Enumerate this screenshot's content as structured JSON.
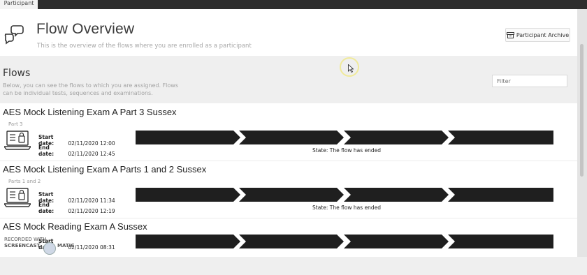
{
  "top_tab": {
    "label": "Participant"
  },
  "header": {
    "title": "Flow Overview",
    "subtitle": "This is the overview of the flows where you are enrolled as a participant",
    "archive_button": "Participant Archive"
  },
  "flows_section": {
    "title": "Flows",
    "description": "Below, you can see the flows to which you are assigned. Flows can be individual tests, sequences and examinations.",
    "filter_placeholder": "Filter"
  },
  "labels": {
    "start": "Start date:",
    "end": "End date:"
  },
  "flows": [
    {
      "name": "AES Mock Listening Exam A Part 3 Sussex",
      "subtitle": "Part 3",
      "start": "02/11/2020 12:00",
      "end": "02/11/2020 12:45",
      "state": "State: The flow has ended"
    },
    {
      "name": "AES Mock Listening Exam A Parts 1 and 2 Sussex",
      "subtitle": "Parts 1 and 2",
      "start": "02/11/2020 11:34",
      "end": "02/11/2020 12:19",
      "state": "State: The flow has ended"
    },
    {
      "name": "AES Mock Reading Exam A Sussex",
      "subtitle": "",
      "start": "02/11/2020 08:31",
      "end": "",
      "state": ""
    }
  ],
  "watermark": {
    "line1": "RECORDED WITH",
    "line2": "SCREENCAST",
    "line3": "MATIC"
  },
  "colors": {
    "progress_segment": "#1f1f1f",
    "topbar": "#2e2e2e",
    "cursor_ring": "#f0ea9a"
  }
}
